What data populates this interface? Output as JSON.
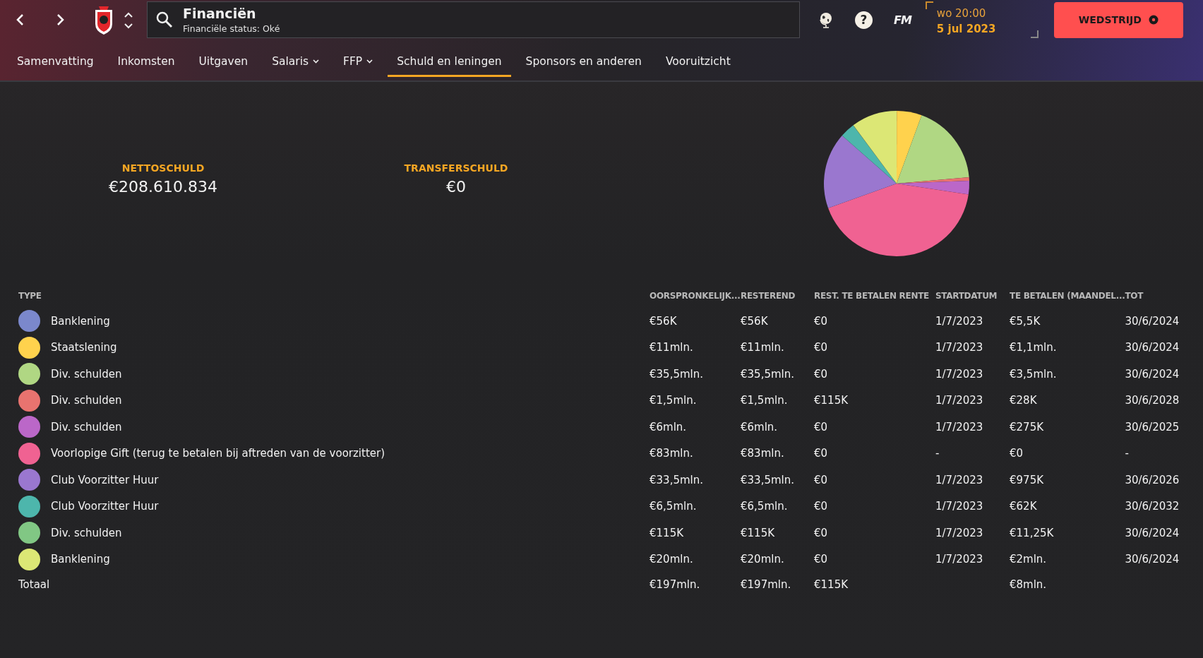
{
  "header": {
    "title": "Financiën",
    "subtitle": "Financiële status: Oké",
    "help": "?",
    "logo": "FM",
    "day_time": "wo 20:00",
    "date": "5 jul 2023",
    "match_button": "WEDSTRIJD"
  },
  "tabs": [
    {
      "label": "Samenvatting",
      "selected": false,
      "dropdown": false
    },
    {
      "label": "Inkomsten",
      "selected": false,
      "dropdown": false
    },
    {
      "label": "Uitgaven",
      "selected": false,
      "dropdown": false
    },
    {
      "label": "Salaris",
      "selected": false,
      "dropdown": true
    },
    {
      "label": "FFP",
      "selected": false,
      "dropdown": true
    },
    {
      "label": "Schuld en leningen",
      "selected": true,
      "dropdown": false
    },
    {
      "label": "Sponsors en anderen",
      "selected": false,
      "dropdown": false
    },
    {
      "label": "Vooruitzicht",
      "selected": false,
      "dropdown": false
    }
  ],
  "summary": [
    {
      "label": "NETTOSCHULD",
      "value": "€208.610.834"
    },
    {
      "label": "TRANSFERSCHULD",
      "value": "€0"
    }
  ],
  "table": {
    "columns": [
      "TYPE",
      "OORSPRONKELIJK...",
      "RESTEREND",
      "REST. TE BETALEN RENTE",
      "STARTDATUM",
      "TE BETALEN (MAANDEL...",
      "TOT"
    ],
    "rows": [
      {
        "color": "#7b88cc",
        "cells": [
          "Banklening",
          "€56K",
          "€56K",
          "€0",
          "1/7/2023",
          "€5,5K",
          "30/6/2024"
        ]
      },
      {
        "color": "#ffd24d",
        "cells": [
          "Staatslening",
          "€11mln.",
          "€11mln.",
          "€0",
          "1/7/2023",
          "€1,1mln.",
          "30/6/2024"
        ]
      },
      {
        "color": "#b0d783",
        "cells": [
          "Div. schulden",
          "€35,5mln.",
          "€35,5mln.",
          "€0",
          "1/7/2023",
          "€3,5mln.",
          "30/6/2024"
        ]
      },
      {
        "color": "#e8736f",
        "cells": [
          "Div. schulden",
          "€1,5mln.",
          "€1,5mln.",
          "€115K",
          "1/7/2023",
          "€28K",
          "30/6/2028"
        ]
      },
      {
        "color": "#bb67c8",
        "cells": [
          "Div. schulden",
          "€6mln.",
          "€6mln.",
          "€0",
          "1/7/2023",
          "€275K",
          "30/6/2025"
        ]
      },
      {
        "color": "#f06292",
        "cells": [
          "Voorlopige Gift (terug te betalen bij aftreden van de voorzitter)",
          "€83mln.",
          "€83mln.",
          "€0",
          "-",
          "€0",
          "-"
        ]
      },
      {
        "color": "#9a77cf",
        "cells": [
          "Club Voorzitter Huur",
          "€33,5mln.",
          "€33,5mln.",
          "€0",
          "1/7/2023",
          "€975K",
          "30/6/2026"
        ]
      },
      {
        "color": "#4db6ac",
        "cells": [
          "Club Voorzitter Huur",
          "€6,5mln.",
          "€6,5mln.",
          "€0",
          "1/7/2023",
          "€62K",
          "30/6/2032"
        ]
      },
      {
        "color": "#81c784",
        "cells": [
          "Div. schulden",
          "€115K",
          "€115K",
          "€0",
          "1/7/2023",
          "€11,25K",
          "30/6/2024"
        ]
      },
      {
        "color": "#dce775",
        "cells": [
          "Banklening",
          "€20mln.",
          "€20mln.",
          "€0",
          "1/7/2023",
          "€2mln.",
          "30/6/2024"
        ]
      }
    ],
    "total": {
      "cells": [
        "Totaal",
        "€197mln.",
        "€197mln.",
        "€115K",
        null,
        "€8mln.",
        null
      ]
    }
  }
}
